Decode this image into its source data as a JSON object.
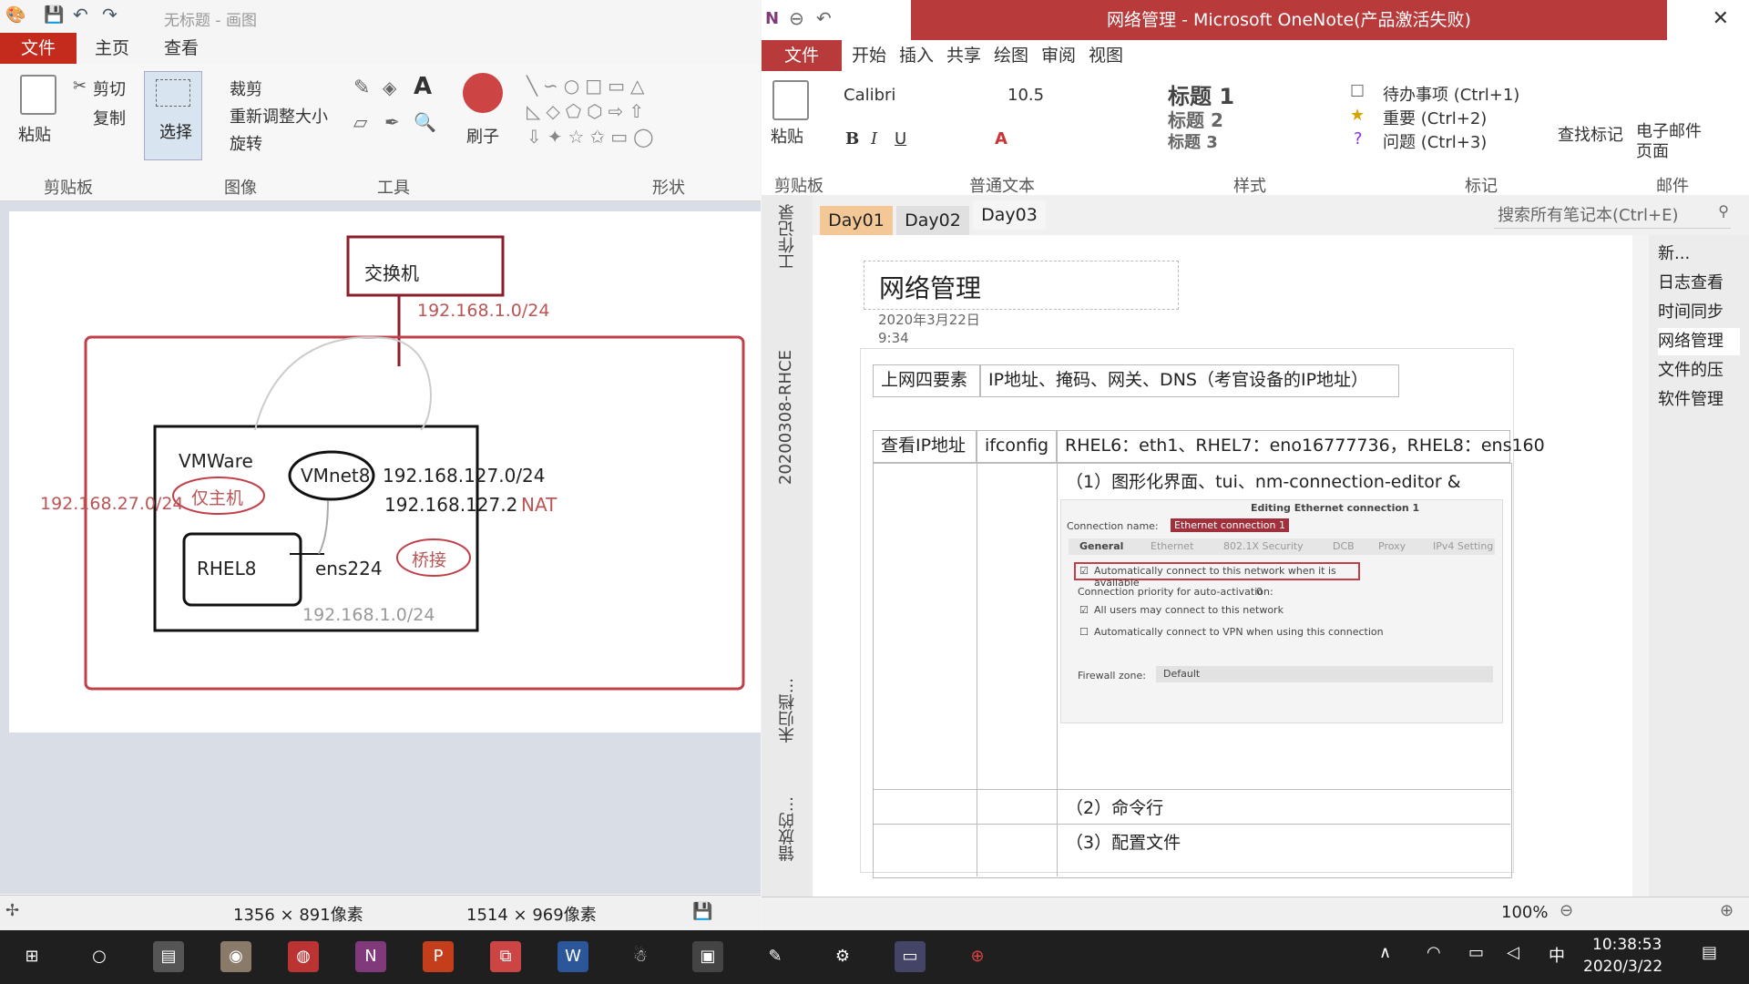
{
  "paint": {
    "title": "无标题 - 画图",
    "tabs": [
      "文件",
      "主页",
      "查看"
    ],
    "clipboard": {
      "paste": "粘贴",
      "cut": "剪切",
      "copy": "复制",
      "label": "剪贴板"
    },
    "image": {
      "select": "选择",
      "crop": "裁剪",
      "resize": "重新调整大小",
      "rotate": "旋转",
      "label": "图像"
    },
    "tools": {
      "label": "工具",
      "brush": "刷子"
    },
    "shapes": {
      "label": "形状"
    },
    "status": {
      "size1": "1356 × 891像素",
      "size2": "1514 × 969像素"
    },
    "diagram": {
      "switch": "交换机",
      "net1": "192.168.1.0/24",
      "vmware": "VMWare",
      "vmnet8": "VMnet8",
      "net127": "192.168.127.0/24",
      "gw127": "192.168.127.2",
      "nat": "NAT",
      "hostonly": "仅主机",
      "net27": "192.168.27.0/24",
      "rhel8": "RHEL8",
      "ens": "ens224",
      "bridge": "桥接",
      "net1b": "192.168.1.0/24"
    }
  },
  "onenote": {
    "title": "网络管理 - Microsoft OneNote(产品激活失败)",
    "menu": [
      "文件",
      "开始",
      "插入",
      "共享",
      "绘图",
      "审阅",
      "视图"
    ],
    "ribbon": {
      "paste": "粘贴",
      "font": "Calibri",
      "size": "10.5",
      "clipboard_label": "剪贴板",
      "text_label": "普通文本",
      "styles": [
        "标题 1",
        "标题 2",
        "标题 3"
      ],
      "styles_label": "样式",
      "tags": [
        "待办事项 (Ctrl+1)",
        "重要 (Ctrl+2)",
        "问题 (Ctrl+3)"
      ],
      "tags_label": "标记",
      "find_tags": "查找标记",
      "email": "电子邮件页面",
      "email_label": "邮件"
    },
    "sections": [
      "工作记录",
      "20200308-RHCE",
      "未归档...",
      "错放的..."
    ],
    "tabs": [
      "Day01",
      "Day02",
      "Day03"
    ],
    "search_placeholder": "搜索所有笔记本(Ctrl+E)",
    "page_title": "网络管理",
    "date": "2020年3月22日",
    "time": "9:34",
    "table": {
      "r1c1": "上网四要素",
      "r1c2": "IP地址、掩码、网关、DNS（考官设备的IP地址）",
      "r2c1": "查看IP地址",
      "r2c2": "ifconfig",
      "r2c3": "RHEL6：eth1、RHEL7：eno16777736，RHEL8：ens160",
      "item1": "（1）图形化界面、tui、nm-connection-editor &",
      "item2": "（2）命令行",
      "item3": "（3）配置文件"
    },
    "dialog": {
      "title": "Editing Ethernet connection 1",
      "conn_name_label": "Connection name:",
      "conn_name": "Ethernet connection 1",
      "tabs": [
        "General",
        "Ethernet",
        "802.1X Security",
        "DCB",
        "Proxy",
        "IPv4 Setting"
      ],
      "auto_connect": "Automatically connect to this network when it is available",
      "priority_label": "Connection priority for auto-activation:",
      "priority": "0",
      "all_users": "All users may connect to this network",
      "vpn": "Automatically connect to VPN when using this connection",
      "firewall_label": "Firewall zone:",
      "firewall": "Default"
    },
    "pages": [
      "新...",
      "日志查看",
      "时间同步",
      "网络管理",
      "文件的压",
      "软件管理"
    ],
    "zoom": "100%"
  },
  "taskbar": {
    "time": "10:38:53",
    "date": "2020/3/22",
    "ime": "中"
  }
}
